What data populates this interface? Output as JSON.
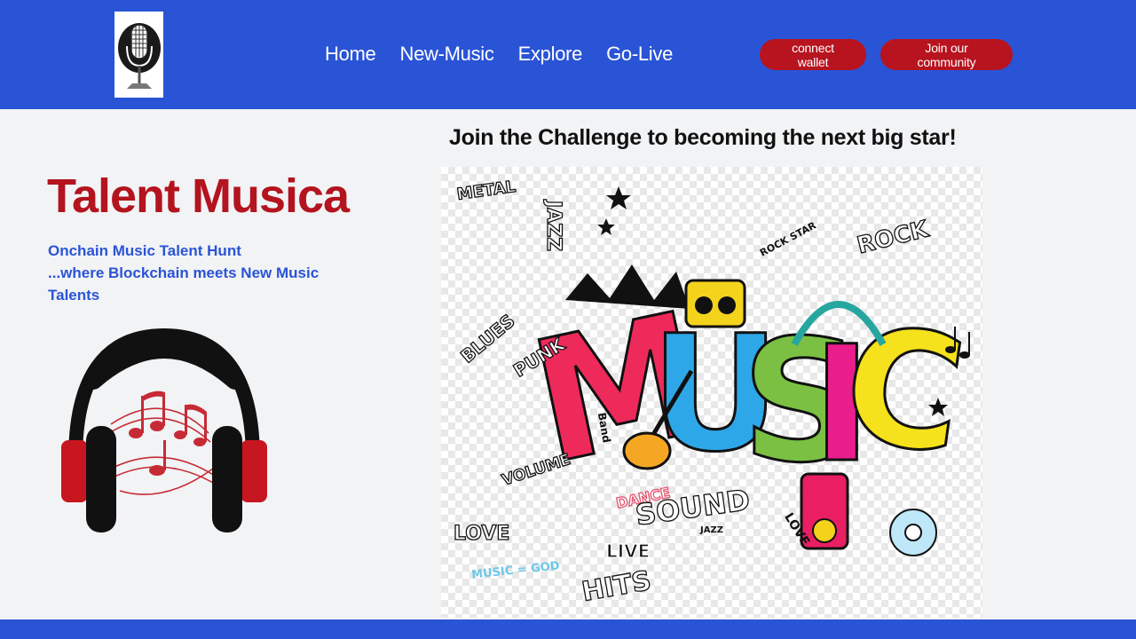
{
  "header": {
    "logo_icon": "microphone-icon",
    "nav": [
      "Home",
      "New-Music",
      "Explore",
      "Go-Live"
    ],
    "connect_wallet_label": "connect wallet",
    "join_community_label": "Join our community"
  },
  "hero": {
    "title": "Talent Musica",
    "tagline_line1": "Onchain Music Talent Hunt",
    "tagline_line2": "...where Blockchain meets New Music Talents",
    "illustration_icon": "headphones-music-notes-icon"
  },
  "challenge": {
    "heading": "Join the Challenge to becoming the next big star!",
    "artwork": {
      "main_word": "MUSIC",
      "doodle_words": [
        "METAL",
        "JAZZ",
        "ROCK",
        "BLUES",
        "PUNK",
        "VOLUME",
        "DANCE",
        "SOUND",
        "LOVE",
        "LIVE",
        "HITS",
        "MUSIC = GOD",
        "ROCK STAR",
        "Band",
        "JAZZ",
        "LOVE"
      ]
    }
  },
  "colors": {
    "brand_blue": "#2a54d6",
    "accent_red": "#b7141f",
    "page_bg": "#f2f3f5"
  }
}
